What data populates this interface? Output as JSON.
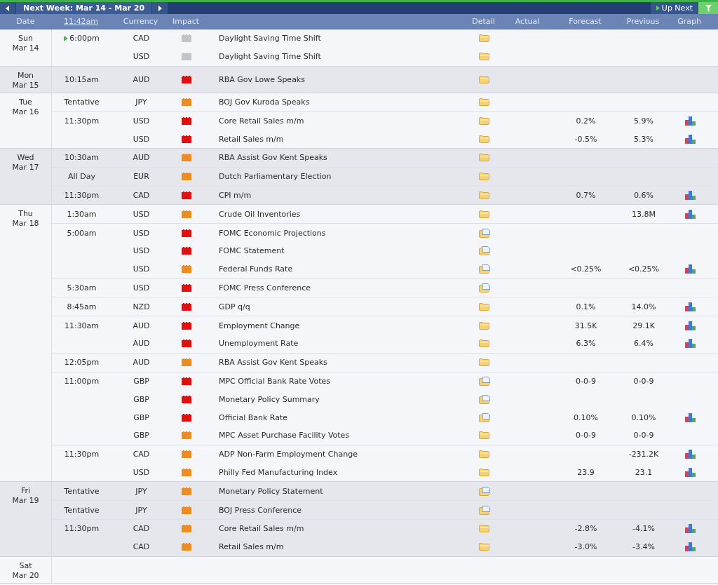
{
  "toolbar": {
    "week_label": "Next Week: Mar 14 - Mar 20",
    "up_next": "Up Next"
  },
  "columns": {
    "date": "Date",
    "time": "11:42am",
    "currency": "Currency",
    "impact": "Impact",
    "detail": "Detail",
    "actual": "Actual",
    "forecast": "Forecast",
    "previous": "Previous",
    "graph": "Graph"
  },
  "days": [
    {
      "day": "Sun",
      "date": "Mar 14",
      "events": [
        {
          "time": "6:00pm",
          "upcoming": true,
          "currency": "CAD",
          "color": "#c4c4c4",
          "event": "Daylight Saving Time Shift",
          "detail_doc": false,
          "graph": false
        },
        {
          "currency": "USD",
          "color": "#c4c4c4",
          "event": "Daylight Saving Time Shift",
          "detail_doc": false,
          "graph": false
        }
      ]
    },
    {
      "day": "Mon",
      "date": "Mar 15",
      "events": [
        {
          "time": "10:15am",
          "upcoming": false,
          "currency": "AUD",
          "color": "#e01010",
          "event": "RBA Gov Lowe Speaks",
          "detail_doc": false,
          "graph": false
        }
      ]
    },
    {
      "day": "Tue",
      "date": "Mar 16",
      "events": [
        {
          "time": "Tentative",
          "upcoming": false,
          "currency": "JPY",
          "color": "#ee8c22",
          "event": "BOJ Gov Kuroda Speaks",
          "detail_doc": false,
          "graph": false
        },
        {
          "time": "11:30pm",
          "upcoming": false,
          "currency": "USD",
          "color": "#e01010",
          "event": "Core Retail Sales m/m",
          "detail_doc": false,
          "forecast": "0.2%",
          "previous": "5.9%",
          "graph": true
        },
        {
          "currency": "USD",
          "color": "#e01010",
          "event": "Retail Sales m/m",
          "detail_doc": false,
          "forecast": "-0.5%",
          "previous": "5.3%",
          "graph": true
        }
      ]
    },
    {
      "day": "Wed",
      "date": "Mar 17",
      "events": [
        {
          "time": "10:30am",
          "upcoming": false,
          "currency": "AUD",
          "color": "#ee8c22",
          "event": "RBA Assist Gov Kent Speaks",
          "detail_doc": false,
          "graph": false
        },
        {
          "time": "All Day",
          "upcoming": false,
          "currency": "EUR",
          "color": "#ee8c22",
          "event": "Dutch Parliamentary Election",
          "detail_doc": false,
          "graph": false
        },
        {
          "time": "11:30pm",
          "upcoming": false,
          "currency": "CAD",
          "color": "#e01010",
          "event": "CPI m/m",
          "detail_doc": false,
          "forecast": "0.7%",
          "previous": "0.6%",
          "graph": true
        }
      ]
    },
    {
      "day": "Thu",
      "date": "Mar 18",
      "events": [
        {
          "time": "1:30am",
          "upcoming": false,
          "currency": "USD",
          "color": "#ee8c22",
          "event": "Crude Oil Inventories",
          "detail_doc": false,
          "previous": "13.8M",
          "graph": true
        },
        {
          "time": "5:00am",
          "upcoming": false,
          "currency": "USD",
          "color": "#e01010",
          "event": "FOMC Economic Projections",
          "detail_doc": true,
          "graph": false
        },
        {
          "currency": "USD",
          "color": "#e01010",
          "event": "FOMC Statement",
          "detail_doc": true,
          "graph": false
        },
        {
          "currency": "USD",
          "color": "#ee8c22",
          "event": "Federal Funds Rate",
          "detail_doc": true,
          "forecast": "<0.25%",
          "previous": "<0.25%",
          "graph": true
        },
        {
          "time": "5:30am",
          "upcoming": false,
          "currency": "USD",
          "color": "#e01010",
          "event": "FOMC Press Conference",
          "detail_doc": true,
          "graph": false
        },
        {
          "time": "8:45am",
          "upcoming": false,
          "currency": "NZD",
          "color": "#e01010",
          "event": "GDP q/q",
          "detail_doc": false,
          "forecast": "0.1%",
          "previous": "14.0%",
          "graph": true
        },
        {
          "time": "11:30am",
          "upcoming": false,
          "currency": "AUD",
          "color": "#e01010",
          "event": "Employment Change",
          "detail_doc": false,
          "forecast": "31.5K",
          "previous": "29.1K",
          "graph": true
        },
        {
          "currency": "AUD",
          "color": "#e01010",
          "event": "Unemployment Rate",
          "detail_doc": false,
          "forecast": "6.3%",
          "previous": "6.4%",
          "graph": true
        },
        {
          "time": "12:05pm",
          "upcoming": false,
          "currency": "AUD",
          "color": "#ee8c22",
          "event": "RBA Assist Gov Kent Speaks",
          "detail_doc": false,
          "graph": false
        },
        {
          "time": "11:00pm",
          "upcoming": false,
          "currency": "GBP",
          "color": "#e01010",
          "event": "MPC Official Bank Rate Votes",
          "detail_doc": true,
          "forecast": "0-0-9",
          "previous": "0-0-9",
          "graph": false
        },
        {
          "currency": "GBP",
          "color": "#e01010",
          "event": "Monetary Policy Summary",
          "detail_doc": true,
          "graph": false
        },
        {
          "currency": "GBP",
          "color": "#e01010",
          "event": "Official Bank Rate",
          "detail_doc": true,
          "forecast": "0.10%",
          "previous": "0.10%",
          "graph": true
        },
        {
          "currency": "GBP",
          "color": "#ee8c22",
          "event": "MPC Asset Purchase Facility Votes",
          "detail_doc": false,
          "forecast": "0-0-9",
          "previous": "0-0-9",
          "graph": false
        },
        {
          "time": "11:30pm",
          "upcoming": false,
          "currency": "CAD",
          "color": "#ee8c22",
          "event": "ADP Non-Farm Employment Change",
          "detail_doc": false,
          "previous": "-231.2K",
          "graph": true
        },
        {
          "currency": "USD",
          "color": "#ee8c22",
          "event": "Philly Fed Manufacturing Index",
          "detail_doc": false,
          "forecast": "23.9",
          "previous": "23.1",
          "graph": true
        }
      ]
    },
    {
      "day": "Fri",
      "date": "Mar 19",
      "events": [
        {
          "time": "Tentative",
          "upcoming": false,
          "currency": "JPY",
          "color": "#ee8c22",
          "event": "Monetary Policy Statement",
          "detail_doc": true,
          "graph": false
        },
        {
          "time": "Tentative",
          "upcoming": false,
          "currency": "JPY",
          "color": "#ee8c22",
          "event": "BOJ Press Conference",
          "detail_doc": true,
          "graph": false
        },
        {
          "time": "11:30pm",
          "upcoming": false,
          "currency": "CAD",
          "color": "#ee8c22",
          "event": "Core Retail Sales m/m",
          "detail_doc": false,
          "forecast": "-2.8%",
          "previous": "-4.1%",
          "graph": true
        },
        {
          "currency": "CAD",
          "color": "#ee8c22",
          "event": "Retail Sales m/m",
          "detail_doc": false,
          "forecast": "-3.0%",
          "previous": "-3.4%",
          "graph": true
        }
      ]
    },
    {
      "day": "Sat",
      "date": "Mar 20"
    }
  ]
}
